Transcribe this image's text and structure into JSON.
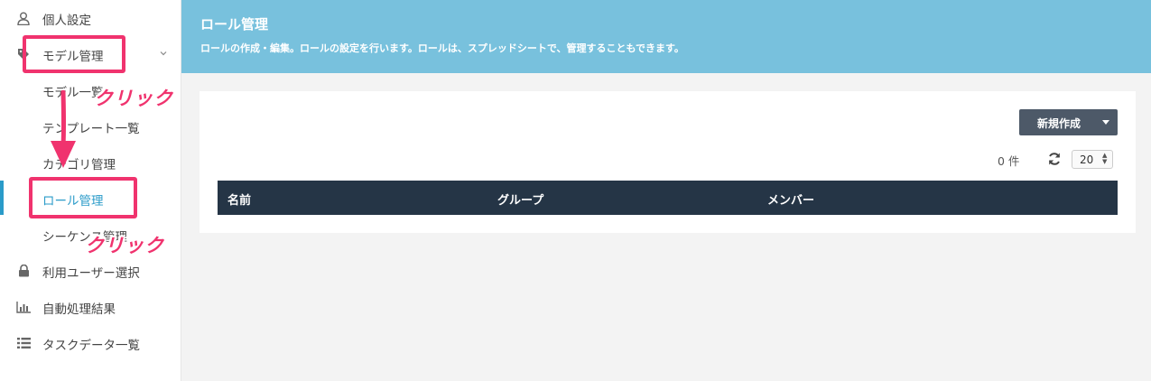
{
  "sidebar": {
    "items": [
      {
        "label": "個人設定",
        "icon": "user-icon"
      },
      {
        "label": "モデル管理",
        "icon": "tag-icon"
      },
      {
        "label": "モデル一覧"
      },
      {
        "label": "テンプレート一覧"
      },
      {
        "label": "カテゴリ管理"
      },
      {
        "label": "ロール管理"
      },
      {
        "label": "シーケンス管理"
      },
      {
        "label": "利用ユーザー選択",
        "icon": "lock-icon"
      },
      {
        "label": "自動処理結果",
        "icon": "bar-chart-icon"
      },
      {
        "label": "タスクデータ一覧",
        "icon": "list-icon"
      }
    ]
  },
  "header": {
    "title": "ロール管理",
    "description": "ロールの作成・編集。ロールの設定を行います。ロールは、スプレッドシートで、管理することもできます。"
  },
  "toolbar": {
    "new_label": "新規作成",
    "count": "0 件",
    "per_page": "20"
  },
  "table": {
    "columns": [
      "名前",
      "グループ",
      "メンバー"
    ]
  },
  "annotations": {
    "click1": "クリック",
    "click2": "クリック"
  },
  "colors": {
    "banner": "#78c1dd",
    "accent": "#2a9bc9",
    "table_header": "#253546",
    "annotation": "#f0336e"
  }
}
